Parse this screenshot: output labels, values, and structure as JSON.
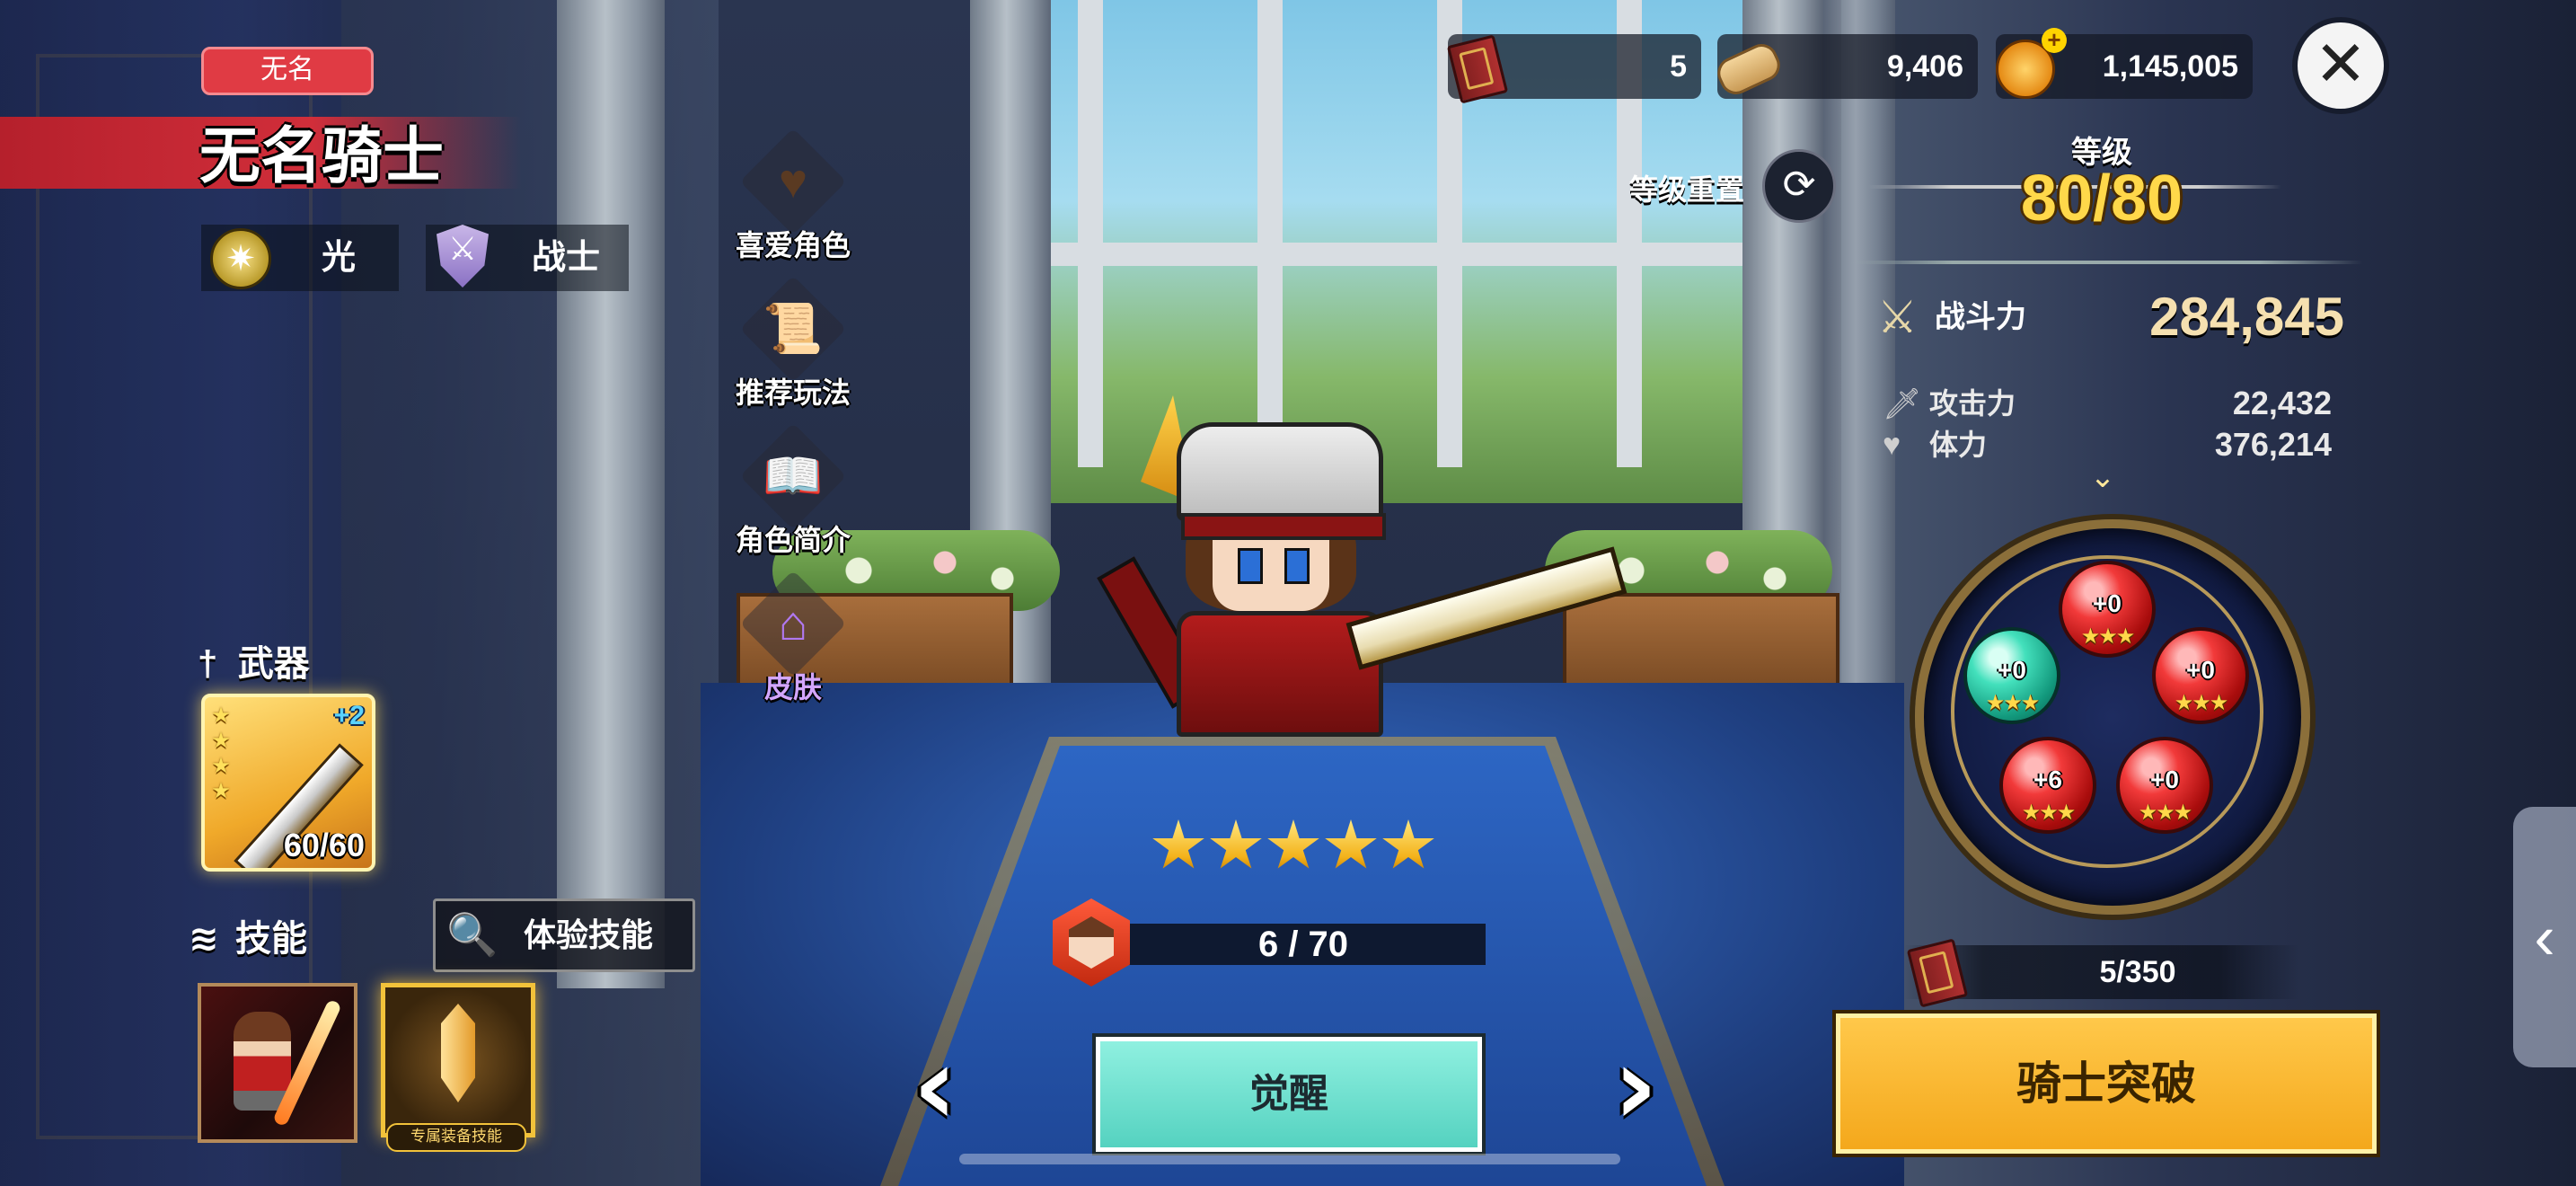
{
  "currencies": {
    "tome": "5",
    "scroll": "9,406",
    "gold": "1,145,005"
  },
  "hero": {
    "title_tag": "无名",
    "name": "无名骑士",
    "element": "光",
    "class": "战士"
  },
  "side_menu": {
    "favorite": "喜爱角色",
    "recommended": "推荐玩法",
    "profile": "角色简介",
    "skin": "皮肤"
  },
  "weapon": {
    "heading": "武器",
    "stars": "★★★★",
    "plus": "+2",
    "count": "60/60"
  },
  "skills": {
    "heading": "技能",
    "try_label": "体验技能",
    "exclusive_tag": "专属装备技能"
  },
  "center": {
    "star_count": 5,
    "shards": "6 / 70",
    "awaken_label": "觉醒",
    "prev": "‹",
    "next": "›"
  },
  "level": {
    "reset_label": "等级重置",
    "label": "等级",
    "value": "80/80"
  },
  "stats": {
    "power_label": "战斗力",
    "power_value": "284,845",
    "attack_label": "攻击力",
    "attack_value": "22,432",
    "hp_label": "体力",
    "hp_value": "376,214"
  },
  "gems": [
    {
      "value": "+0",
      "stars": "★★★",
      "color": "red"
    },
    {
      "value": "+0",
      "stars": "★★★",
      "color": "teal"
    },
    {
      "value": "+0",
      "stars": "★★★",
      "color": "red"
    },
    {
      "value": "+6",
      "stars": "★★★",
      "color": "red"
    },
    {
      "value": "+0",
      "stars": "★★★",
      "color": "red"
    }
  ],
  "breakthrough": {
    "tomes": "5/350",
    "label": "骑士突破"
  },
  "icons": {
    "close": "✕",
    "reset": "⟳",
    "search": "🔍",
    "side_tab": "‹"
  },
  "colors": {
    "accent_gold": "#ffd84a",
    "awaken_teal": "#55d2c0",
    "break_orange": "#f4a81c",
    "title_red": "#e03b44"
  }
}
